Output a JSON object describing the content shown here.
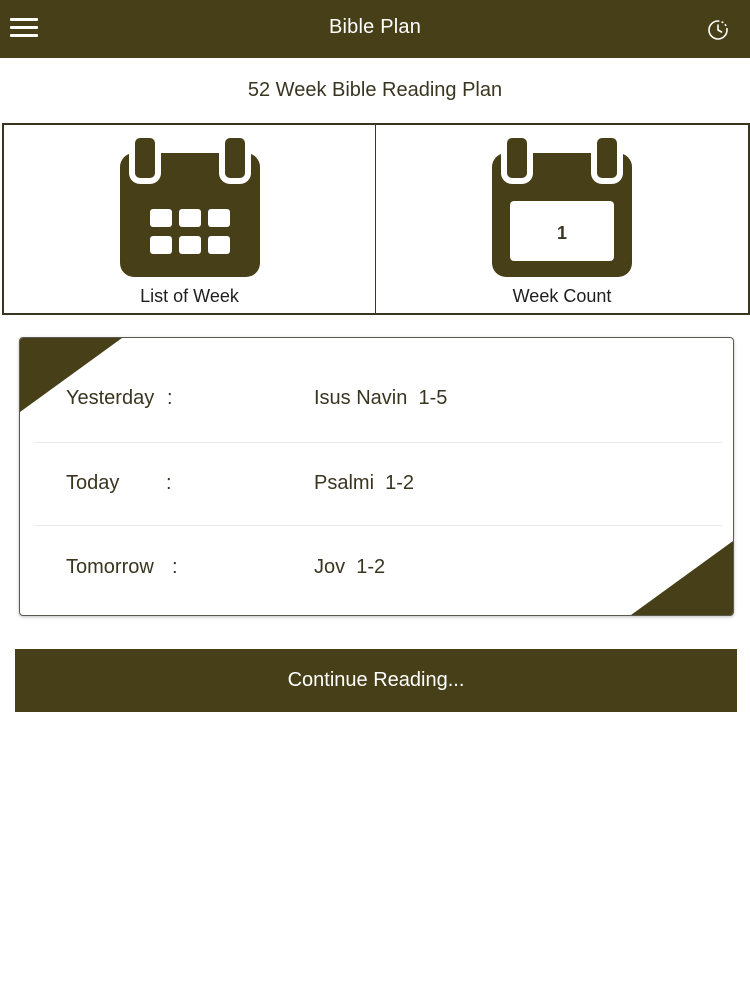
{
  "header": {
    "title": "Bible Plan",
    "menu_icon": "hamburger-menu-icon",
    "history_icon": "history-clock-icon"
  },
  "subtitle": "52 Week Bible Reading Plan",
  "tiles": {
    "list_of_week": {
      "label": "List of Week",
      "icon": "calendar-grid-icon"
    },
    "week_count": {
      "label": "Week Count",
      "value": "1",
      "icon": "calendar-number-icon"
    }
  },
  "readings": [
    {
      "day": "Yesterday",
      "sep": ":",
      "reading": "Isus Navin  1-5"
    },
    {
      "day": "Today",
      "sep": ":",
      "reading": "Psalmi  1-2"
    },
    {
      "day": "Tomorrow",
      "sep": ":",
      "reading": "Jov  1-2"
    }
  ],
  "continue_label": "Continue Reading...",
  "colors": {
    "brand": "#463f17",
    "text": "#3a3520",
    "background": "#ffffff"
  }
}
